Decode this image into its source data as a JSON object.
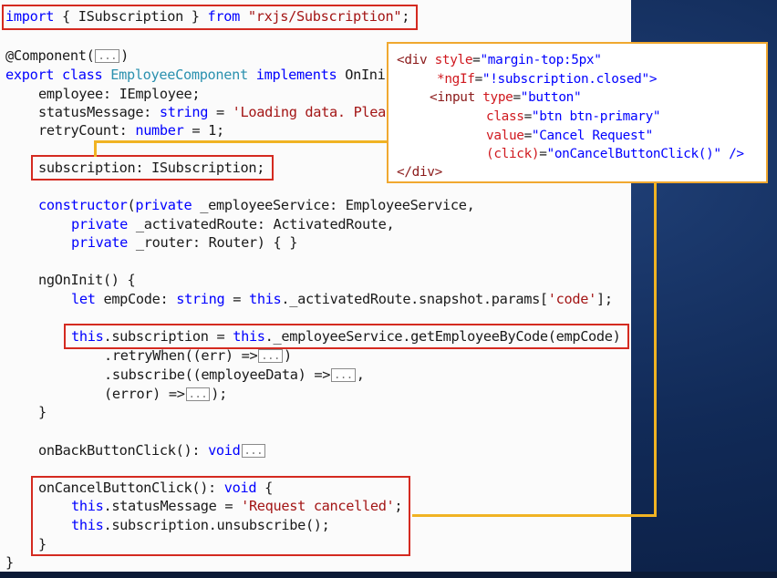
{
  "code": {
    "import_kw": "import",
    "import_rest": " { ISubscription } ",
    "from_kw": "from",
    "import_path": "\"rxjs/Subscription\"",
    "semicolon": ";",
    "component_decorator": "@Component(",
    "component_close": ")",
    "fold": "...",
    "export_kw": "export",
    "class_kw": "class",
    "class_name": "EmployeeComponent",
    "implements_kw": "implements",
    "impl_rest": "OnIni",
    "employee_line": "employee: IEmployee;",
    "status_prop": "statusMessage: ",
    "string_type": "string",
    "status_eq": " = ",
    "loading_str": "'Loading data. Plea",
    "retry_prop": "retryCount: ",
    "number_type": "number",
    "retry_val": " = 1;",
    "subscription_line": "subscription: ISubscription;",
    "constructor_kw": "constructor",
    "private_kw": "private",
    "ctor_p1": " _employeeService: EmployeeService,",
    "ctor_p2": " _activatedRoute: ActivatedRoute,",
    "ctor_p3": " _router: Router) { }",
    "ngoninit": "ngOnInit() {",
    "let_kw": "let",
    "empcode_decl": " empCode: ",
    "this_kw": "this",
    "route_rest": "._activatedRoute.snapshot.params[",
    "code_str": "'code'",
    "route_end": "];",
    "sub_assign_a": ".subscription = ",
    "sub_assign_b": "._employeeService.getEmployeeByCode(empCode)",
    "retry_when": ".retryWhen((err) =>",
    "subscribe_line": ".subscribe((employeeData) =>",
    "error_line": "(error) =>",
    "close_paren_semi": ");",
    "comma": ",",
    "close_paren": ")",
    "close_brace": "}",
    "back_click": "onBackButtonClick(): ",
    "void_kw": "void",
    "cancel_click": "onCancelButtonClick(): ",
    "open_brace": " {",
    "status_assign": ".statusMessage = ",
    "cancel_str": "'Request cancelled'",
    "unsub": ".subscription.unsubscribe();"
  },
  "popup": {
    "div_open": "<div ",
    "style_attr": "style",
    "style_val": "\"margin-top:5px\"",
    "ngif_attr": "*ngIf",
    "ngif_val": "\"!subscription.closed\"",
    "gt": ">",
    "input_open": "<input ",
    "type_attr": "type",
    "type_val": "\"button\"",
    "class_attr": "class",
    "class_val": "\"btn btn-primary\"",
    "value_attr": "value",
    "value_val": "\"Cancel Request\"",
    "click_attr": "(click)",
    "click_val": "\"onCancelButtonClick()\"",
    "self_close": " />",
    "div_close": "</div>",
    "eq": "="
  },
  "colors": {
    "highlight_box": "#d42a20",
    "connector": "#f0b323",
    "popup_border": "#f0a830",
    "background": "#112a57"
  }
}
